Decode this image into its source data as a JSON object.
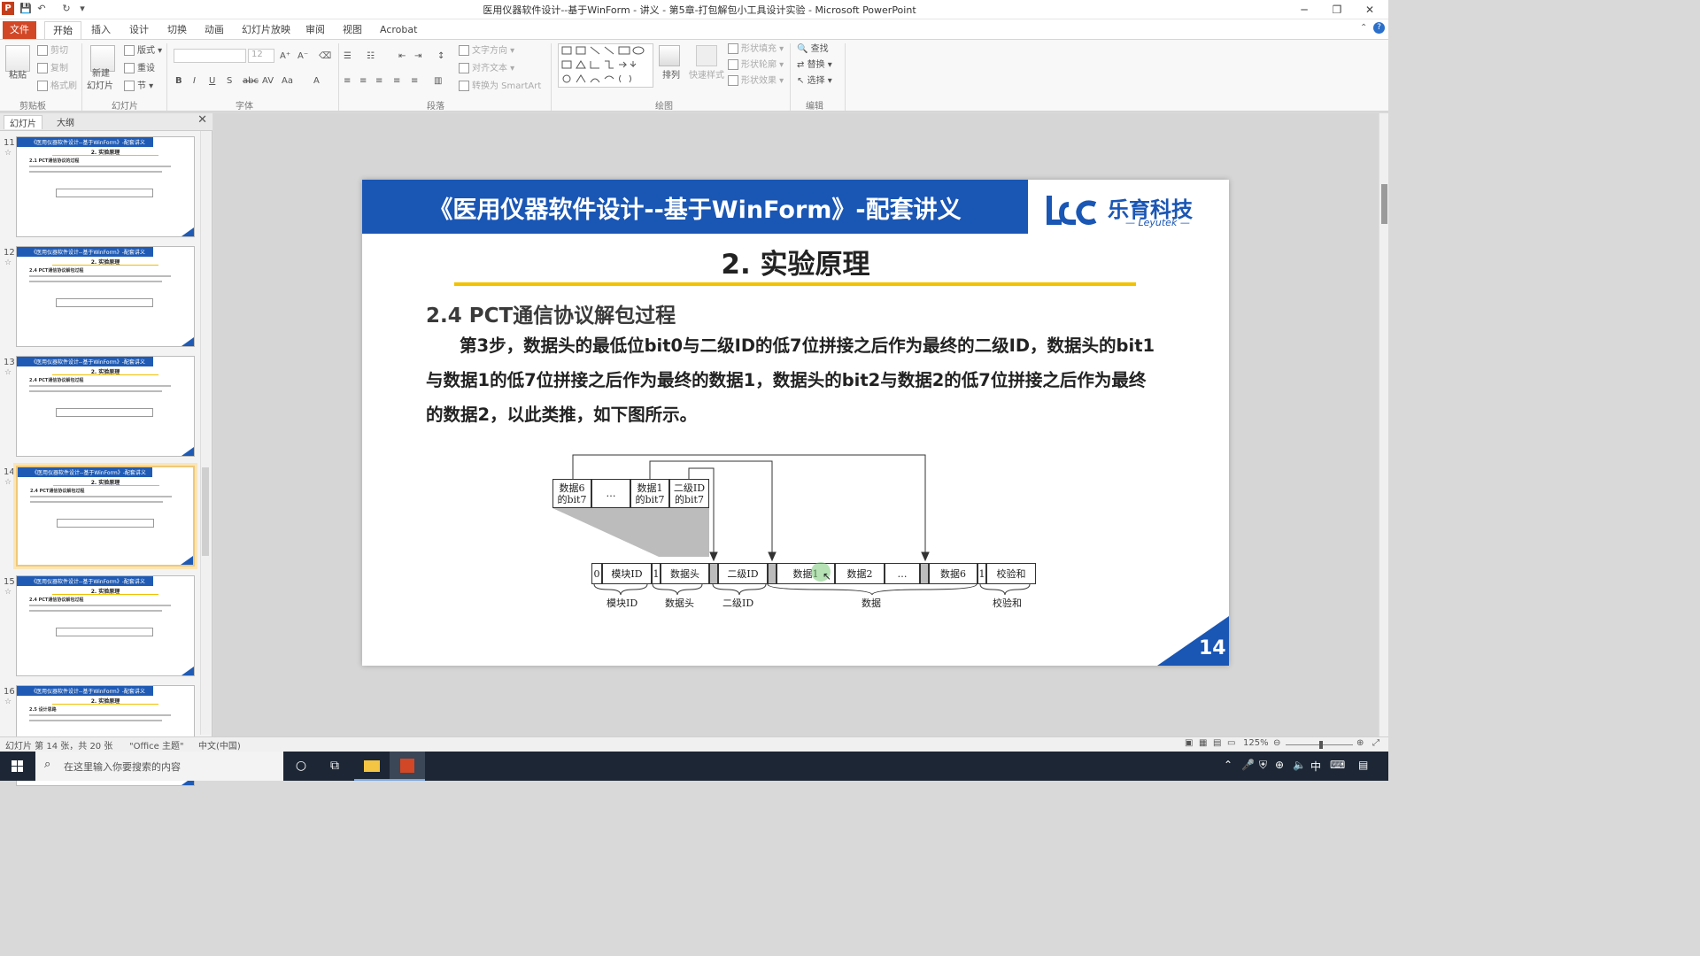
{
  "window": {
    "title": "医用仪器软件设计--基于WinForm - 讲义 - 第5章-打包解包小工具设计实验 - Microsoft PowerPoint",
    "app_icon_letter": "P"
  },
  "ribbon_tabs": [
    "文件",
    "开始",
    "插入",
    "设计",
    "切换",
    "动画",
    "幻灯片放映",
    "审阅",
    "视图",
    "Acrobat"
  ],
  "ribbon": {
    "clipboard": {
      "paste": "粘贴",
      "cut": "剪切",
      "copy": "复制",
      "format_painter": "格式刷",
      "label": "剪贴板"
    },
    "slides": {
      "new_slide": "新建",
      "new_slide2": "幻灯片",
      "layout": "版式",
      "reset": "重设",
      "section": "节",
      "label": "幻灯片"
    },
    "font": {
      "size": "12",
      "label": "字体"
    },
    "paragraph": {
      "text_direction": "文字方向",
      "align_text": "对齐文本",
      "smartart": "转换为 SmartArt",
      "label": "段落"
    },
    "drawing": {
      "arrange": "排列",
      "quick_styles": "快速样式",
      "shape_fill": "形状填充",
      "shape_outline": "形状轮廓",
      "shape_effects": "形状效果",
      "label": "绘图"
    },
    "editing": {
      "find": "查找",
      "replace": "替换",
      "select": "选择",
      "label": "编辑"
    }
  },
  "pane": {
    "tab_slides": "幻灯片",
    "tab_outline": "大纲",
    "thumbnails": [
      {
        "num": "11",
        "sub": "2.1 PCT通信协议的过程"
      },
      {
        "num": "12",
        "sub": "2.4 PCT通信协议解包过程"
      },
      {
        "num": "13",
        "sub": "2.4 PCT通信协议解包过程"
      },
      {
        "num": "14",
        "sub": "2.4 PCT通信协议解包过程"
      },
      {
        "num": "15",
        "sub": "2.4 PCT通信协议解包过程"
      },
      {
        "num": "16",
        "sub": "2.5 设计思路"
      }
    ],
    "thumb_title": "《医用仪器软件设计--基于WinForm》-配套讲义",
    "thumb_heading": "2. 实验原理"
  },
  "slide": {
    "banner_title": "《医用仪器软件设计--基于WinForm》-配套讲义",
    "logo_cn": "乐育科技",
    "logo_en": "— Leyutek —",
    "heading": "2. 实验原理",
    "subheading": "2.4 PCT通信协议解包过程",
    "body": "第3步，数据头的最低位bit0与二级ID的低7位拼接之后作为最终的二级ID，数据头的bit1与数据1的低7位拼接之后作为最终的数据1，数据头的bit2与数据2的低7位拼接之后作为最终的数据2，以此类推，如下图所示。",
    "page_number": "14",
    "diagram": {
      "top_cells": [
        "数据6\n的bit7",
        "…",
        "数据1\n的bit7",
        "二级ID\n的bit7"
      ],
      "row_cells": [
        "0",
        "模块ID",
        "1",
        "数据头",
        "二级ID",
        "数据1",
        "数据2",
        "…",
        "数据6",
        "1",
        "校验和"
      ],
      "brace_labels": [
        "模块ID",
        "数据头",
        "二级ID",
        "数据",
        "校验和"
      ]
    }
  },
  "statusbar": {
    "slide_info": "幻灯片 第 14 张，共 20 张",
    "theme": "\"Office 主题\"",
    "language": "中文(中国)",
    "zoom": "125%"
  },
  "taskbar": {
    "search_placeholder": "在这里输入你要搜索的内容",
    "ime": "中"
  },
  "colors": {
    "banner_blue": "#1a56b4",
    "accent_yellow": "#f2c200",
    "file_tab": "#d24726"
  }
}
